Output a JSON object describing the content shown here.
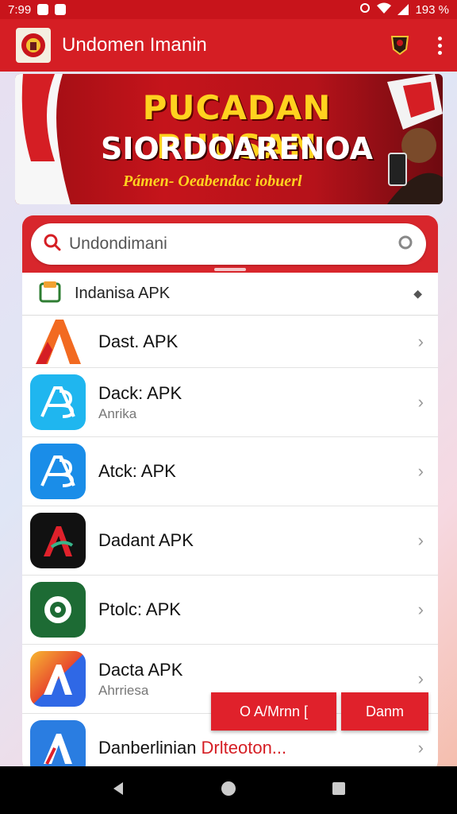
{
  "status_bar": {
    "time": "7:99",
    "battery": "193 %"
  },
  "app_bar": {
    "title": "Undomen Imanin"
  },
  "banner": {
    "headline": "PUCADAN PUUSAN",
    "subheadline": "SIORDOARENOA",
    "tagline": "Pámen- Oeabendac iobuerl"
  },
  "search": {
    "value": "Undondimani"
  },
  "dropdown": {
    "label": "Indanisa APK"
  },
  "apps": [
    {
      "name": "Dast. APK",
      "subtitle": ""
    },
    {
      "name": "Dack: APK",
      "subtitle": "Anrika"
    },
    {
      "name": "Atck: APK",
      "subtitle": ""
    },
    {
      "name": "Dadant APK",
      "subtitle": ""
    },
    {
      "name": "Ptolc: APK",
      "subtitle": ""
    },
    {
      "name": "Dacta APK",
      "subtitle": "Ahrriesa"
    },
    {
      "name": "Danberlinian",
      "subtitle": "",
      "extra": "Drlteoton..."
    }
  ],
  "buttons": {
    "primary": "O A/Mrnn [",
    "secondary": "Danm"
  },
  "colors": {
    "brand_red": "#d51e24",
    "status_red": "#c8141b",
    "accent_yellow": "#ffd21f"
  }
}
